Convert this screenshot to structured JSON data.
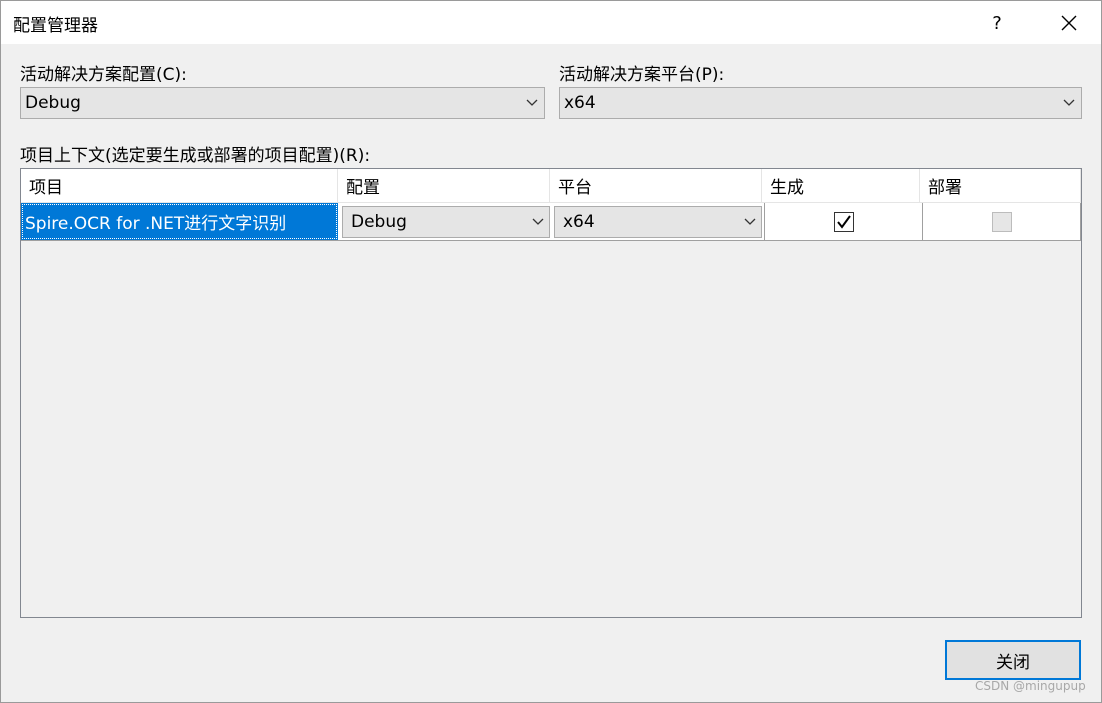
{
  "window": {
    "title": "配置管理器",
    "help": "?"
  },
  "solution_config": {
    "label": "活动解决方案配置(C):",
    "value": "Debug"
  },
  "solution_platform": {
    "label": "活动解决方案平台(P):",
    "value": "x64"
  },
  "project_context_label": "项目上下文(选定要生成或部署的项目配置)(R):",
  "grid": {
    "headers": [
      "项目",
      "配置",
      "平台",
      "生成",
      "部署"
    ],
    "rows": [
      {
        "project": "Spire.OCR for .NET进行文字识别",
        "config": "Debug",
        "platform": "x64",
        "build": true,
        "deploy": false
      }
    ]
  },
  "footer": {
    "close_label": "关闭"
  },
  "watermark": "CSDN @mingupup",
  "colors": {
    "selection": "#0078d7",
    "background": "#f0f0f0"
  }
}
